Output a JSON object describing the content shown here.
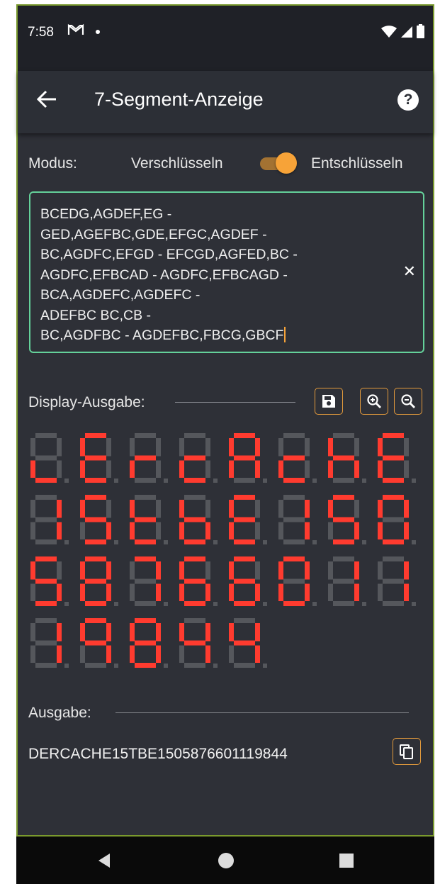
{
  "status_bar": {
    "time": "7:58"
  },
  "app_bar": {
    "title": "7-Segment-Anzeige"
  },
  "mode": {
    "label": "Modus:",
    "option_left": "Verschlüsseln",
    "option_right": "Entschlüsseln",
    "selected": "Entschlüsseln"
  },
  "input": {
    "lines": [
      "BCEDG,AGDEF,EG -",
      "GED,AGEFBC,GDE,EFGC,AGDEF -",
      "BC,AGDFC,EFGD - EFCGD,AGFED,BC -",
      "AGDFC,EFBCAD - AGDFC,EFBCAGD -",
      "BCA,AGDEFC,AGDEFC -",
      "ADEFBC BC,CB -",
      "BC,AGDFBC - AGDEFBC,FBCG,GBCF"
    ]
  },
  "display_section": {
    "label": "Display-Ausgabe:"
  },
  "display_digits": [
    "de",
    "adefg",
    "eg",
    "deg",
    "abcefg",
    "deg",
    "cefg",
    "adefg",
    "bc",
    "acdfg",
    "defg",
    "cdefg",
    "adefg",
    "bc",
    "acdfg",
    "abcdef",
    "acdfg",
    "abcdefg",
    "abc",
    "acdefg",
    "acdefg",
    "abcdef",
    "bc",
    "bc",
    "bc",
    "abcfg",
    "abcdefg",
    "bcfg",
    "bcfg"
  ],
  "output_section": {
    "label": "Ausgabe:",
    "value": "DERCACHE15TBE1505876601119844"
  },
  "colors": {
    "accent": "#f7a338",
    "segment_on": "#ff3b2f",
    "segment_off": "#55575c",
    "border_focus": "#64d19a"
  },
  "icons": [
    "back-arrow-icon",
    "help-icon",
    "clear-icon",
    "save-icon",
    "zoom-in-icon",
    "zoom-out-icon",
    "copy-icon"
  ]
}
